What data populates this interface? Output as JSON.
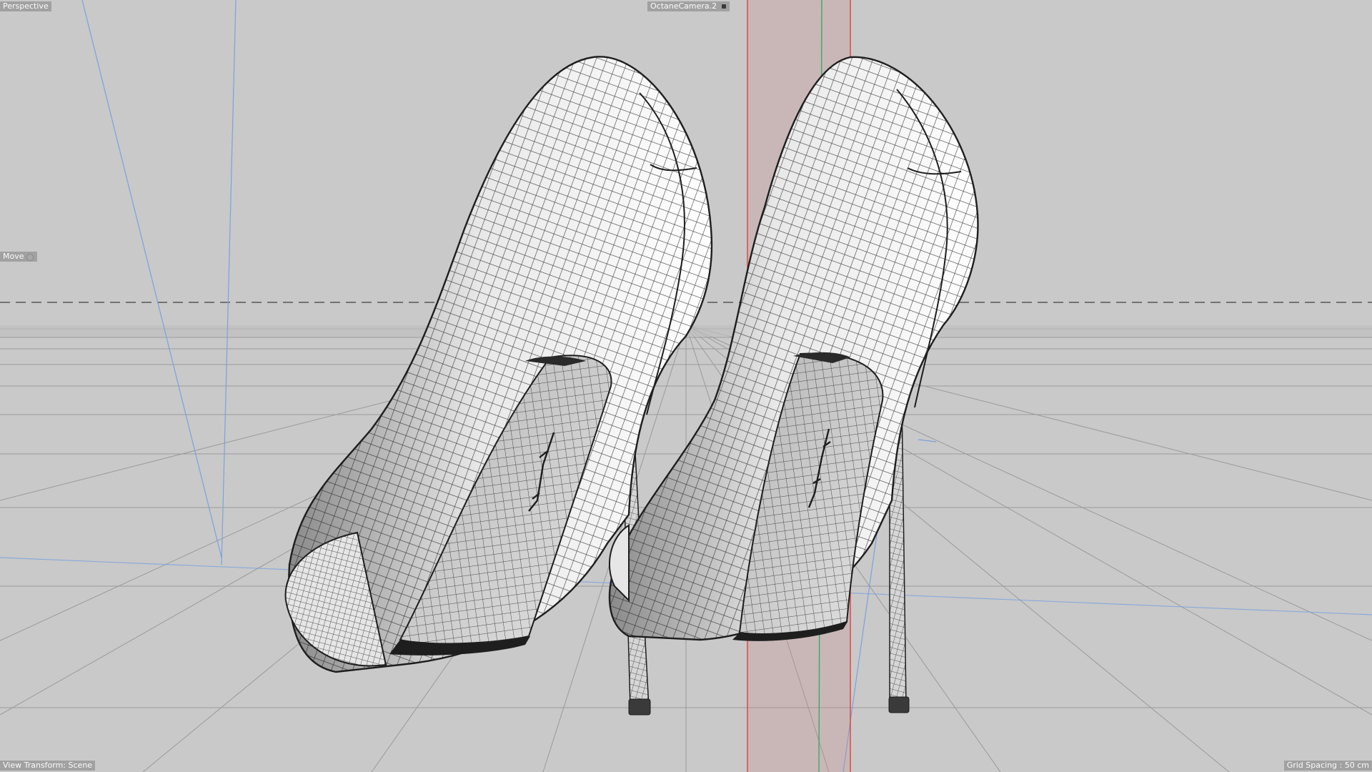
{
  "viewport": {
    "view_name": "Perspective",
    "camera_name": "OctaneCamera.2",
    "active_tool": "Move",
    "view_transform": "View Transform: Scene",
    "grid_spacing": "Grid Spacing : 50 cm"
  },
  "icons": {
    "camera_indicator": "camera-lock-icon",
    "tool_indicator": "tool-settings-icon"
  },
  "colors": {
    "background": "#c9c9c9",
    "grid": "#9a9a9a",
    "horizon_dash": "#555555",
    "wire": "#1e1e1e",
    "mesh_fill": "#f0f0f0",
    "axis_x_red": "#e0403c",
    "axis_y_green": "#3ca86a",
    "axis_z_blue": "#5a8ad8",
    "selection_tint": "#c88a8a"
  },
  "scene": {
    "object": "pair of high-heel pumps",
    "display_mode": "wireframe over shaded"
  }
}
